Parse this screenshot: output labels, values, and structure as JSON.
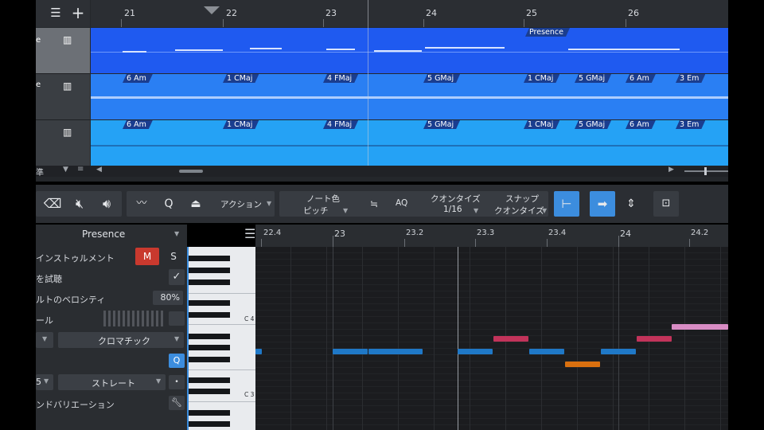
{
  "arrange": {
    "ruler": [
      "21",
      "22",
      "23",
      "24",
      "25",
      "26"
    ],
    "presence_tag": "Presence",
    "track2_chords": [
      "6 Am",
      "1 CMaj",
      "4 FMaj",
      "5 GMaj",
      "1 CMaj",
      "5 GMaj",
      "6 Am",
      "3 Em"
    ],
    "track3_chords": [
      "6 Am",
      "1 CMaj",
      "4 FMaj",
      "5 GMaj",
      "1 CMaj",
      "5 GMaj",
      "6 Am",
      "3 Em"
    ],
    "footer_label": "準"
  },
  "toolbar": {
    "action_label": "アクション",
    "note_color_label": "ノート色",
    "note_color_value": "ピッチ",
    "aq_label": "AQ",
    "quantize_label": "クオンタイズ",
    "quantize_value": "1/16",
    "snap_label": "スナップ",
    "snap_value": "クオンタイズ"
  },
  "inspector": {
    "track_name": "Presence",
    "instrument_label": "インストゥルメント",
    "mute_label": "M",
    "solo_label": "S",
    "audition_label": "を試聴",
    "velocity_label": "ルトのベロシティ",
    "velocity_value": "80%",
    "scale_label": "ール",
    "scale_value": "クロマチック",
    "q_label": "Q",
    "quantize_mode_value": "ストレート",
    "quantize_prefix": "5",
    "variation_label": "ンドバリエーション"
  },
  "editor": {
    "ruler": [
      "22.4",
      "23",
      "23.2",
      "23.3",
      "23.4",
      "24",
      "24.2"
    ],
    "key_labels": [
      "C 4",
      "C 3"
    ]
  },
  "colors": {
    "track1": "#1f5af0",
    "track2": "#2a7ff3",
    "track3": "#25a2f5",
    "note_blue": "#1f78c7",
    "note_red": "#c2335a",
    "note_orange": "#d9700f",
    "note_pink": "#d88cc4",
    "mute_red": "#c9392e",
    "accent": "#3c8dde"
  }
}
